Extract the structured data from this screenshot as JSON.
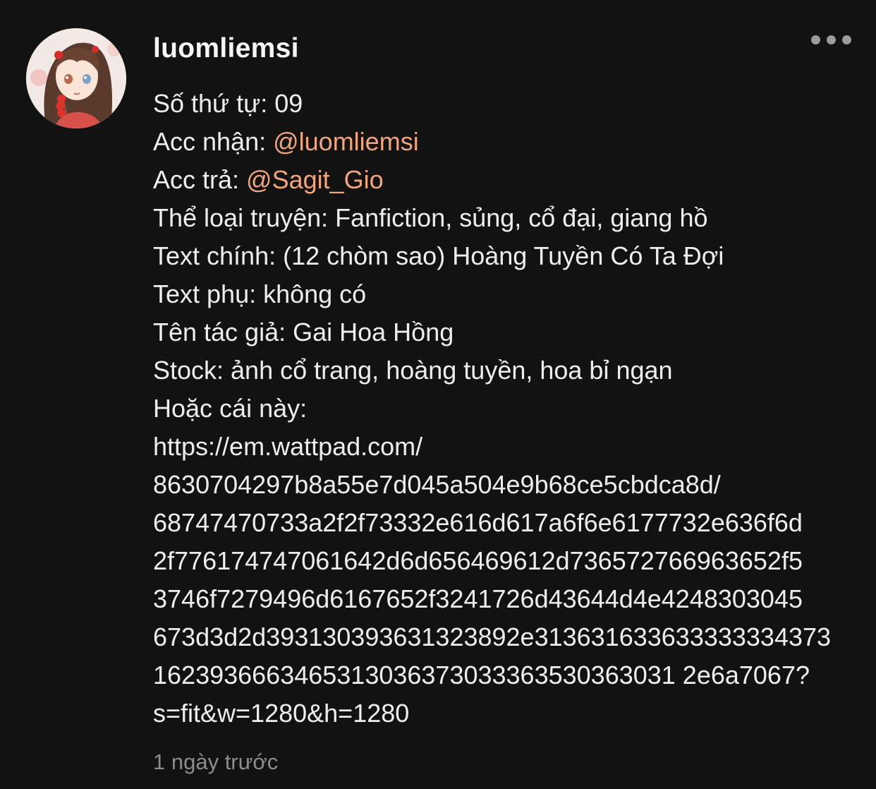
{
  "comment": {
    "username": "luomliemsi",
    "more_icon": "more-horizontal-icon",
    "avatar_icon": "user-avatar-anime-girl",
    "colors": {
      "background": "#121212",
      "text": "#eeeeee",
      "mention": "#f2a57c",
      "muted": "#8c8c8c"
    },
    "lines": [
      {
        "label": "Số thứ tự: 09"
      },
      {
        "label": "Acc nhận: ",
        "mention": "@luomliemsi"
      },
      {
        "label": "Acc trả: ",
        "mention": "@Sagit_Gio"
      },
      {
        "label": "Thể loại truyện: Fanfiction, sủng, cổ đại, giang hồ"
      },
      {
        "label": "Text chính: (12 chòm sao) Hoàng Tuyền Có Ta Đợi"
      },
      {
        "label": "Text phụ: không có"
      },
      {
        "label": "Tên tác giả: Gai Hoa Hồng"
      },
      {
        "label": "Stock: ảnh cổ trang, hoàng tuyền, hoa bỉ ngạn"
      },
      {
        "label": "Hoặc cái này:"
      }
    ],
    "url_lines": [
      "https://em.wattpad.com/",
      "8630704297b8a55e7d045a504e9b68ce5cbdca8d/",
      "68747470733a2f2f73332e616d617a6f6e6177732e636f6d",
      "2f776174747061642d6d656469612d736572766963652f5",
      "3746f7279496d6167652f3241726d43644d4e4248303045",
      "673d3d2d393130393631323892e313631633633333334373",
      "1623936663465313036373033363530363031 2e6a7067?",
      "s=fit&w=1280&h=1280"
    ],
    "timestamp": "1 ngày trước"
  }
}
